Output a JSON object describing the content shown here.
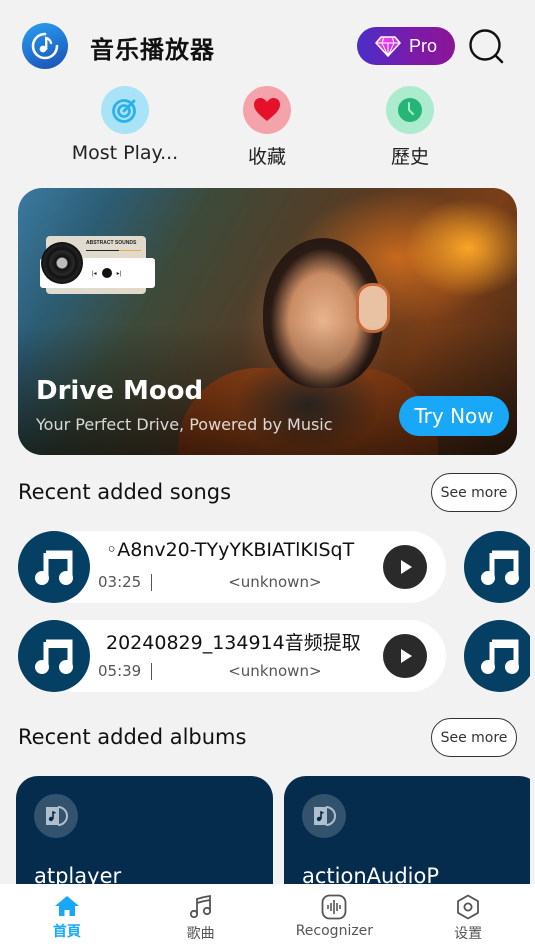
{
  "header": {
    "app_title": "音乐播放器",
    "pro_label": "Pro",
    "logo_icon": "music-disc-icon",
    "search_icon": "search-icon",
    "pro_icon": "diamond-icon"
  },
  "quick_actions": [
    {
      "label": "Most Play...",
      "icon": "target-icon",
      "bg": "#a9e3f7",
      "fg": "#2cb1ea"
    },
    {
      "label": "收藏",
      "icon": "heart-icon",
      "bg": "#f5a3ab",
      "fg": "#e5102a"
    },
    {
      "label": "歷史",
      "icon": "clock-icon",
      "bg": "#acebcd",
      "fg": "#25b577"
    }
  ],
  "banner": {
    "title": "Drive Mood",
    "subtitle": "Your Perfect Drive, Powered by Music",
    "cta": "Try Now",
    "mini_player_title": "ABSTRACT SOUNDS"
  },
  "recent_songs": {
    "title": "Recent added songs",
    "see_more": "See more",
    "items": [
      {
        "title": "◦A8nv20-TYyYKBIATlKISqT",
        "duration": "03:25",
        "artist": "<unknown>"
      },
      {
        "title": "20240829_134914音频提取",
        "duration": "05:39",
        "artist": "<unknown>"
      }
    ]
  },
  "recent_albums": {
    "title": "Recent added albums",
    "see_more": "See more",
    "items": [
      {
        "name": "atplayer"
      },
      {
        "name": "actionAudioP"
      }
    ]
  },
  "bottom_nav": [
    {
      "label": "首頁",
      "icon": "home-icon",
      "active": true
    },
    {
      "label": "歌曲",
      "icon": "music-note-icon",
      "active": false
    },
    {
      "label": "Recognizer",
      "icon": "sound-wave-icon",
      "active": false
    },
    {
      "label": "设置",
      "icon": "settings-hexagon-icon",
      "active": false
    }
  ],
  "colors": {
    "accent": "#19a8f7",
    "song_art": "#053f63",
    "album_card": "#062c4d",
    "play_button": "#2a2a2a",
    "background": "#f2f2f2"
  }
}
